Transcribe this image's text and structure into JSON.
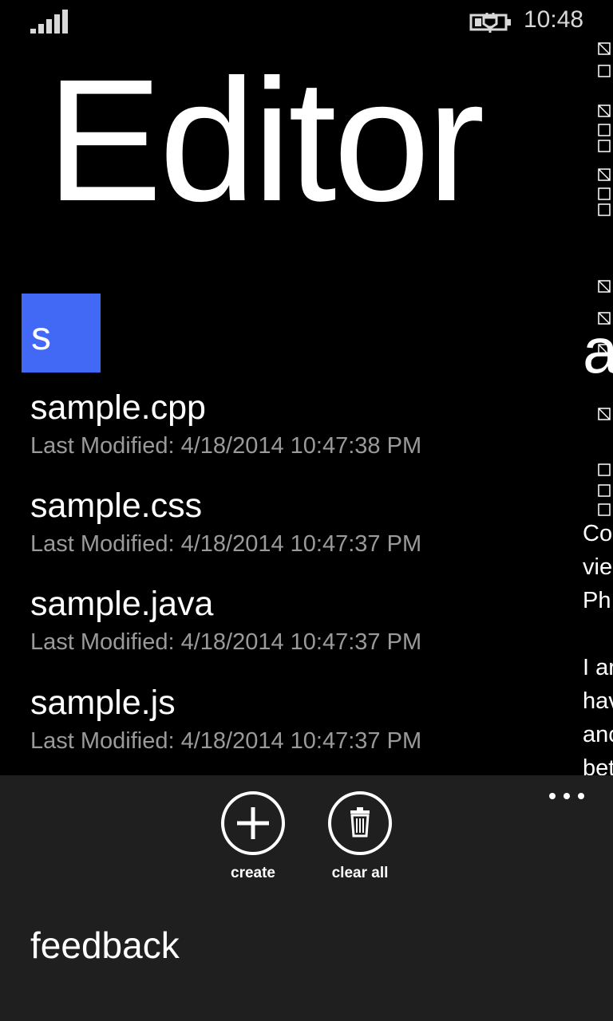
{
  "status_bar": {
    "time": "10:48",
    "signal_icon": "signal-strength-icon",
    "battery_icon": "battery-charging-icon"
  },
  "title": "Editor",
  "group": {
    "letter": "s",
    "tile_color": "#4169f6"
  },
  "files": [
    {
      "name": "sample.cpp",
      "modified": "Last Modified: 4/18/2014 10:47:38 PM"
    },
    {
      "name": "sample.css",
      "modified": "Last Modified: 4/18/2014 10:47:37 PM"
    },
    {
      "name": "sample.java",
      "modified": "Last Modified: 4/18/2014 10:47:37 PM"
    },
    {
      "name": "sample.js",
      "modified": "Last Modified: 4/18/2014 10:47:37 PM"
    }
  ],
  "peek": {
    "heading": "a",
    "text": "Co\nvie\nPh\n\nI ar\nhav\nanc\nbet"
  },
  "app_bar": {
    "buttons": [
      {
        "label": "create",
        "icon": "add-icon"
      },
      {
        "label": "clear all",
        "icon": "trash-icon"
      }
    ],
    "more_icon": "more-ellipsis-icon",
    "menu_items": [
      {
        "label": "feedback"
      }
    ],
    "background": "#1f1f1f"
  }
}
